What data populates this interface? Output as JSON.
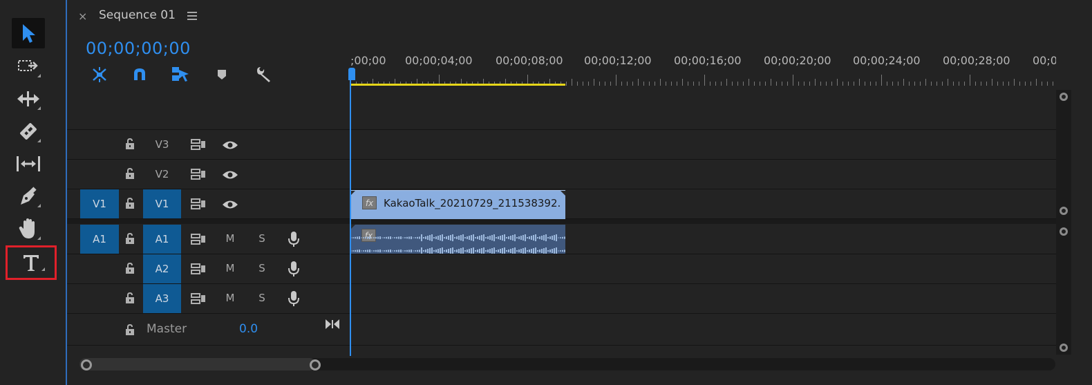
{
  "tools": [
    {
      "name": "selection-tool",
      "icon": "arrow-icon",
      "active": true
    },
    {
      "name": "track-select-tool",
      "icon": "track-select-icon"
    },
    {
      "name": "ripple-edit-tool",
      "icon": "ripple-edit-icon"
    },
    {
      "name": "razor-tool",
      "icon": "razor-icon"
    },
    {
      "name": "slip-tool",
      "icon": "slip-icon"
    },
    {
      "name": "pen-tool",
      "icon": "pen-icon"
    },
    {
      "name": "hand-tool",
      "icon": "hand-icon"
    },
    {
      "name": "type-tool",
      "icon": "type-icon",
      "highlighted": true,
      "label": "T"
    }
  ],
  "panel": {
    "close": "×",
    "title": "Sequence 01",
    "timecode": "00;00;00;00"
  },
  "ruler": {
    "labels": [
      ";00;00",
      "00;00;04;00",
      "00;00;08;00",
      "00;00;12;00",
      "00;00;16;00",
      "00;00;20;00",
      "00;00;24;00",
      "00;00;28;00",
      "00;0("
    ]
  },
  "tracks": {
    "video": [
      {
        "name": "V3",
        "source": "",
        "targeted": false
      },
      {
        "name": "V2",
        "source": "",
        "targeted": false
      },
      {
        "name": "V1",
        "source": "V1",
        "targeted": true
      }
    ],
    "audio": [
      {
        "name": "A1",
        "source": "A1",
        "targeted": true,
        "m": "M",
        "s": "S"
      },
      {
        "name": "A2",
        "source": "",
        "targeted": true,
        "m": "M",
        "s": "S"
      },
      {
        "name": "A3",
        "source": "",
        "targeted": true,
        "m": "M",
        "s": "S"
      }
    ],
    "master": {
      "label": "Master",
      "volume": "0.0"
    }
  },
  "clips": {
    "video_name": "KakaoTalk_20210729_211538392.",
    "fx": "fx"
  },
  "colors": {
    "accent": "#2f8ff0",
    "target": "#0f5a94",
    "video_clip": "#8aaee0",
    "audio_clip": "#40587d",
    "work_area": "#e6d619",
    "highlight": "#e0202a"
  }
}
